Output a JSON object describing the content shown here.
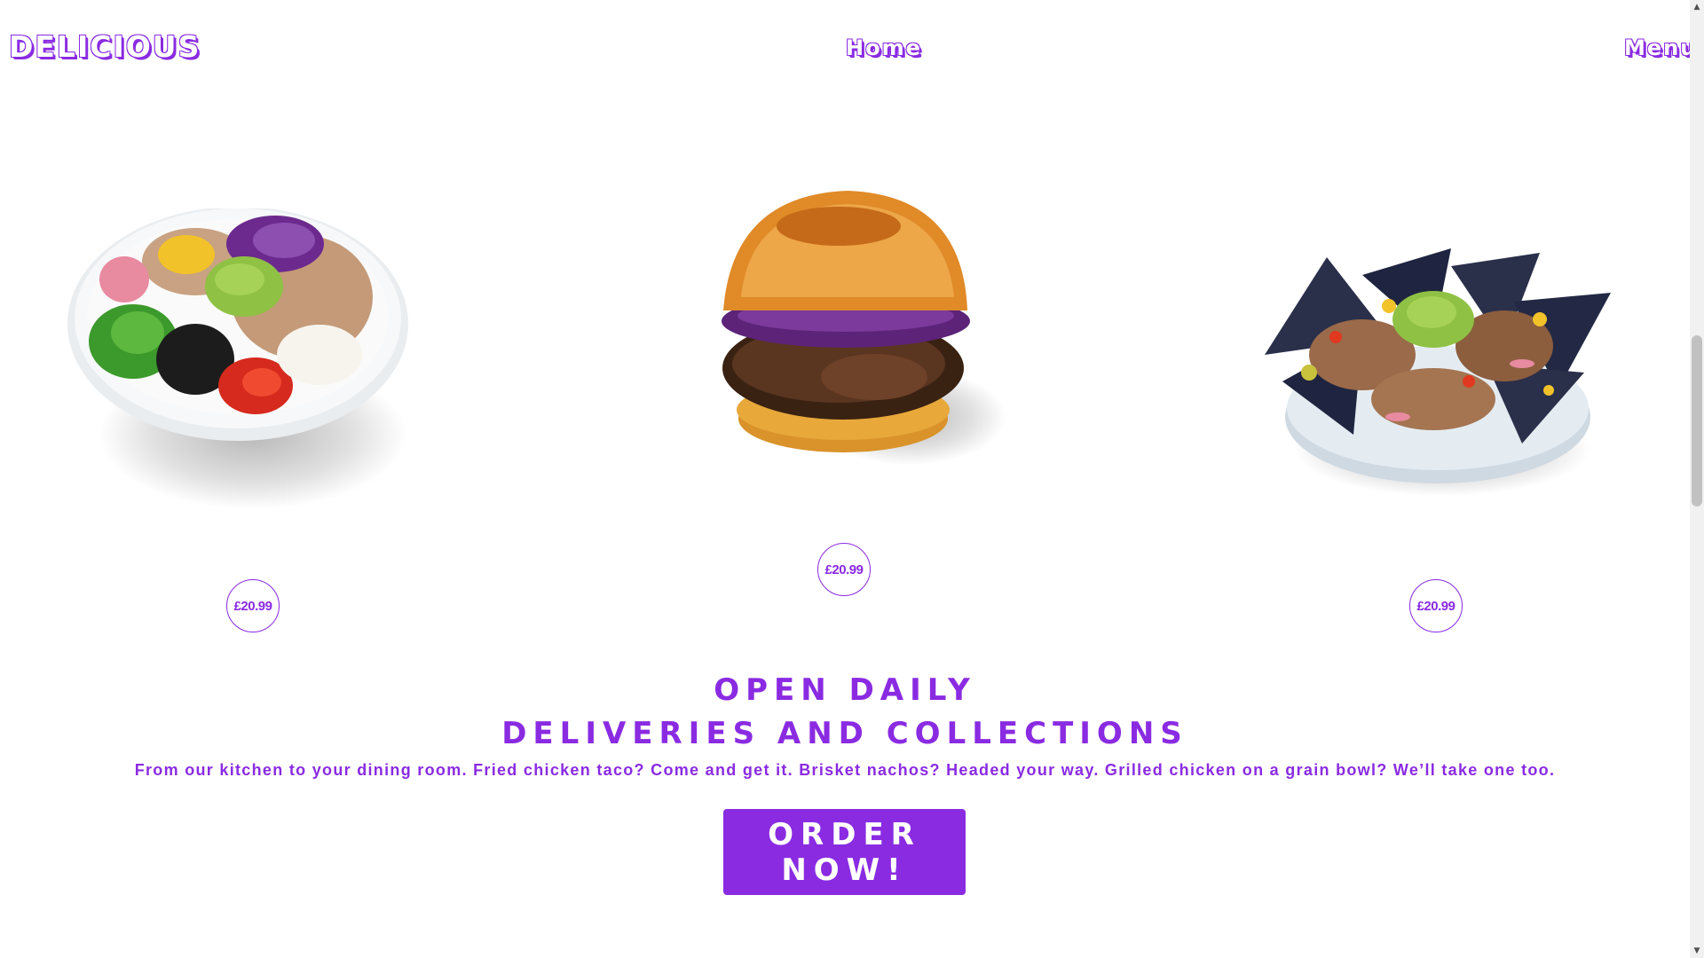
{
  "nav": {
    "logo": "DELICIOUS",
    "home": "Home",
    "menu": "Menu"
  },
  "products": [
    {
      "name": "grain-bowl",
      "price": "£20.99"
    },
    {
      "name": "brisket-burger",
      "price": "£20.99"
    },
    {
      "name": "brisket-nachos",
      "price": "£20.99"
    }
  ],
  "info": {
    "heading1": "OPEN DAILY",
    "heading2": "DELIVERIES AND COLLECTIONS",
    "description": "From our kitchen to your dining room. Fried chicken taco? Come and get it. Brisket nachos? Headed your way. Grilled chicken on a grain bowl? We’ll take one too.",
    "order_button": "ORDER NOW!"
  },
  "colors": {
    "accent": "#8a2be2",
    "background": "#ffffff"
  },
  "icons": {
    "scroll_up": "triangle-up-icon",
    "scroll_down": "triangle-down-icon"
  }
}
